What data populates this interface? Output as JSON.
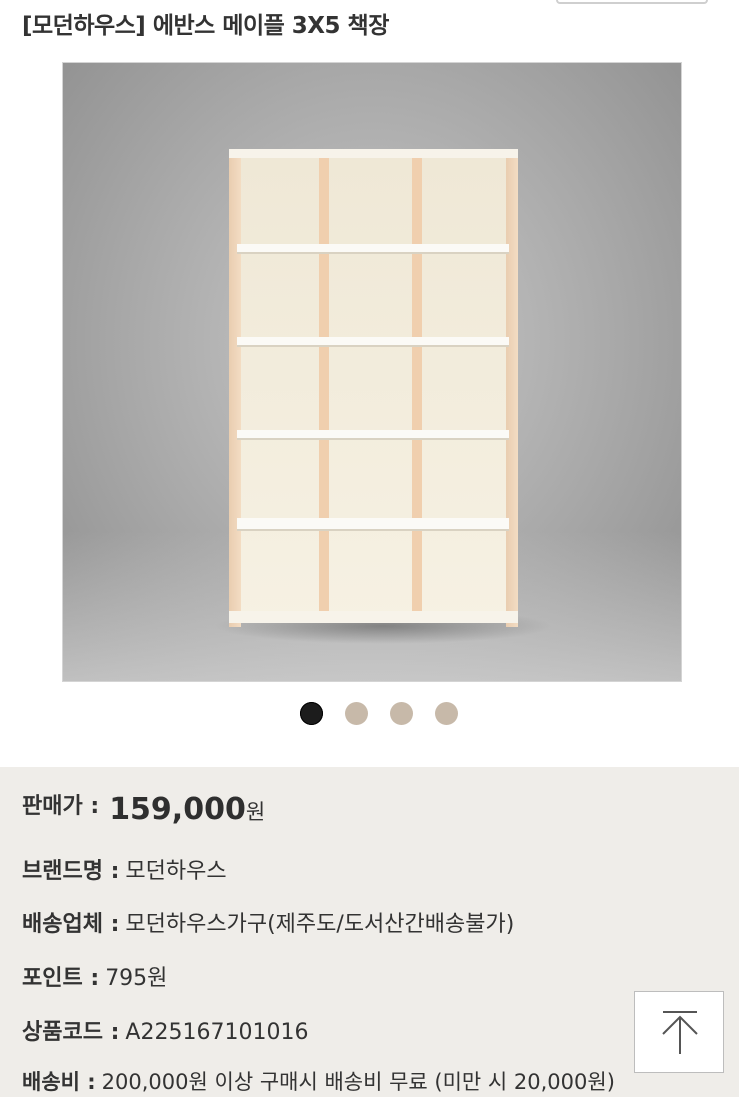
{
  "product": {
    "title": "[모던하우스] 에반스 메이플 3X5 책장"
  },
  "gallery": {
    "image_alt": "에반스 메이플 3X5 책장",
    "slide_count": 4,
    "active_index": 0
  },
  "info": {
    "price_label": "판매가 :",
    "price_value": "159,000",
    "price_unit": "원",
    "brand_label": "브랜드명 :",
    "brand_value": "모던하우스",
    "shipper_label": "배송업체 :",
    "shipper_value": "모던하우스가구(제주도/도서산간배송불가)",
    "points_label": "포인트 :",
    "points_value": "795원",
    "code_label": "상품코드 :",
    "code_value": "A225167101016",
    "shipping_label": "배송비 :",
    "shipping_value": "200,000원 이상 구매시 배송비 무료 (미만 시 20,000원)"
  },
  "colors": {
    "panel_bg": "#efede9",
    "dot_active": "#1c1c1c",
    "dot_inactive": "#c7b9a9"
  },
  "icons": {
    "scroll_top": "arrow-up-to-line-icon"
  }
}
